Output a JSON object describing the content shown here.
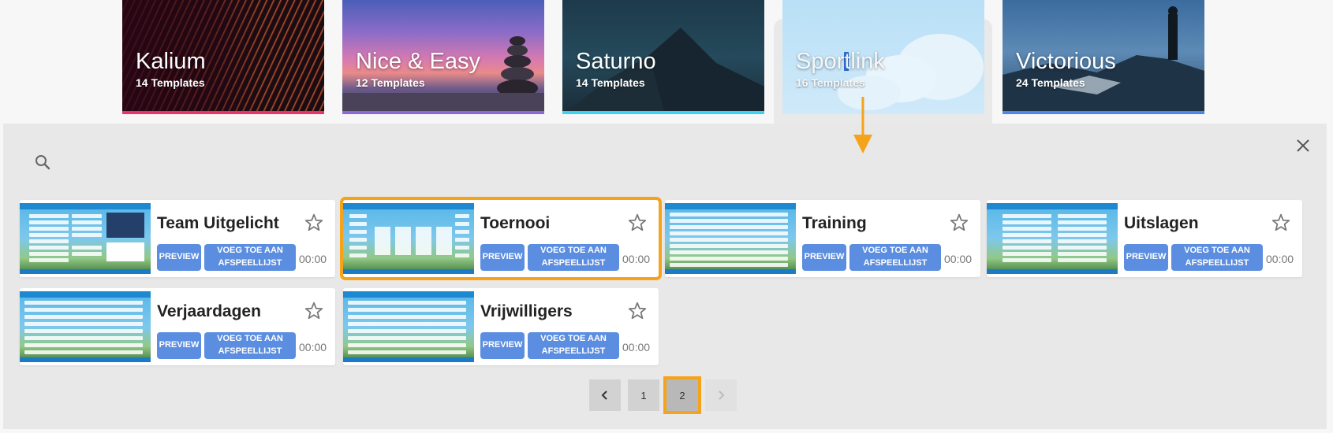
{
  "categories": [
    {
      "title": "Kalium",
      "count": "14 Templates",
      "bar_color": "#e8336b"
    },
    {
      "title": "Nice & Easy",
      "count": "12 Templates",
      "bar_color": "#8a6ad8"
    },
    {
      "title": "Saturno",
      "count": "14 Templates",
      "bar_color": "#3fd1f0"
    },
    {
      "title": "Sportlink",
      "count": "16 Templates",
      "bar_color": "#cfe7f7",
      "selected": true
    },
    {
      "title": "Victorious",
      "count": "24 Templates",
      "bar_color": "#4f86e8"
    }
  ],
  "templates": [
    {
      "title": "Team Uitgelicht",
      "preview": "PREVIEW",
      "add": "VOEG TOE AAN\nAFSPEELLIJST",
      "duration": "00:00"
    },
    {
      "title": "Toernooi",
      "preview": "PREVIEW",
      "add": "VOEG TOE AAN\nAFSPEELLIJST",
      "duration": "00:00",
      "highlighted": true
    },
    {
      "title": "Training",
      "preview": "PREVIEW",
      "add": "VOEG TOE AAN\nAFSPEELLIJST",
      "duration": "00:00"
    },
    {
      "title": "Uitslagen",
      "preview": "PREVIEW",
      "add": "VOEG TOE AAN\nAFSPEELLIJST",
      "duration": "00:00"
    },
    {
      "title": "Verjaardagen",
      "preview": "PREVIEW",
      "add": "VOEG TOE AAN\nAFSPEELLIJST",
      "duration": "00:00"
    },
    {
      "title": "Vrijwilligers",
      "preview": "PREVIEW",
      "add": "VOEG TOE AAN\nAFSPEELLIJST",
      "duration": "00:00"
    }
  ],
  "pagination": {
    "prev_icon": "chevron-left-icon",
    "pages": [
      "1",
      "2"
    ],
    "current": "2",
    "next_icon": "chevron-right-icon"
  },
  "colors": {
    "accent": "#f5a31a",
    "button": "#5b8ee0"
  },
  "icons": {
    "search": "search-icon",
    "close": "close-icon",
    "favorite": "star-outline-icon"
  }
}
